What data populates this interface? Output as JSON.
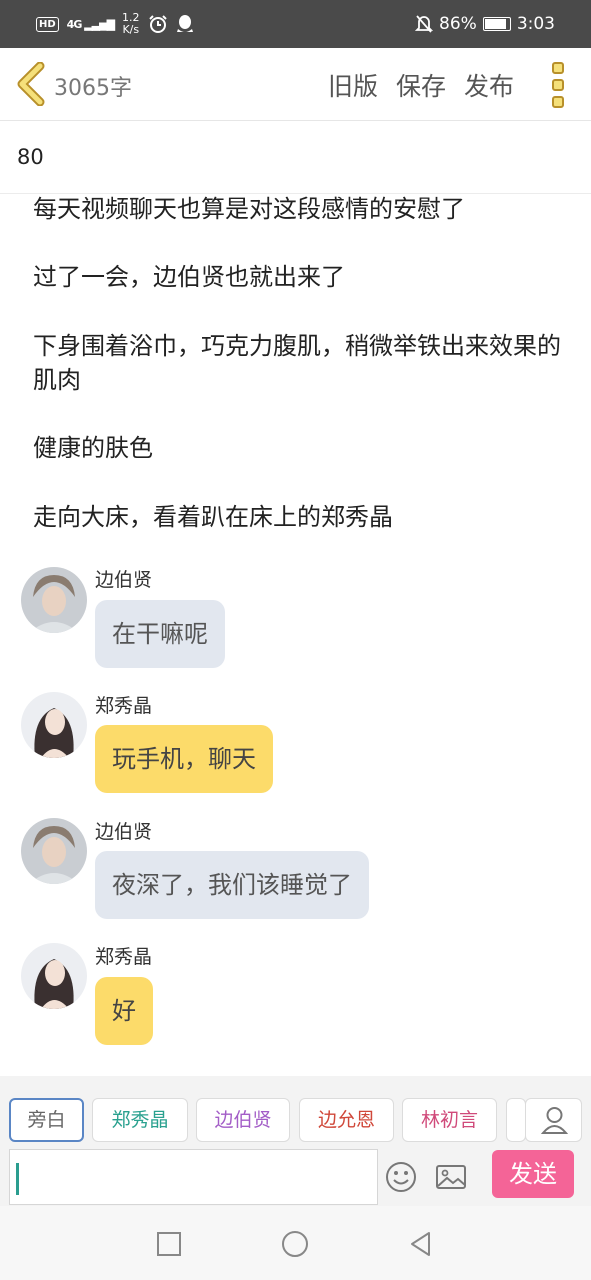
{
  "status_bar": {
    "hd": "HD",
    "signal": "4G",
    "speed_value": "1.2",
    "speed_unit": "K/s",
    "battery": "86%",
    "time": "3:03"
  },
  "header": {
    "word_count": "3065字",
    "old_version": "旧版",
    "save": "保存",
    "publish": "发布"
  },
  "chapter": {
    "number": "80"
  },
  "paragraphs": [
    "每天视频聊天也算是对这段感情的安慰了",
    "过了一会，边伯贤也就出来了",
    "下身围着浴巾，巧克力腹肌，稍微举铁出来效果的肌肉",
    "健康的肤色",
    "走向大床，看着趴在床上的郑秀晶"
  ],
  "messages": [
    {
      "name": "边伯贤",
      "text": "在干嘛呢"
    },
    {
      "name": "郑秀晶",
      "text": "玩手机，聊天"
    },
    {
      "name": "边伯贤",
      "text": "夜深了，我们该睡觉了"
    },
    {
      "name": "郑秀晶",
      "text": "好"
    }
  ],
  "characters": [
    "旁白",
    "郑秀晶",
    "边伯贤",
    "边允恩",
    "林初言"
  ],
  "editor": {
    "input_value": "",
    "send": "发送"
  },
  "colors": {
    "chip_green": "#2aa18f",
    "chip_purple": "#a35ec7",
    "chip_red": "#d0483a",
    "chip_pink": "#d04a7a",
    "send": "#f46497",
    "bubble_gray": "#e2e7ef",
    "bubble_yellow": "#fcdb6a"
  }
}
